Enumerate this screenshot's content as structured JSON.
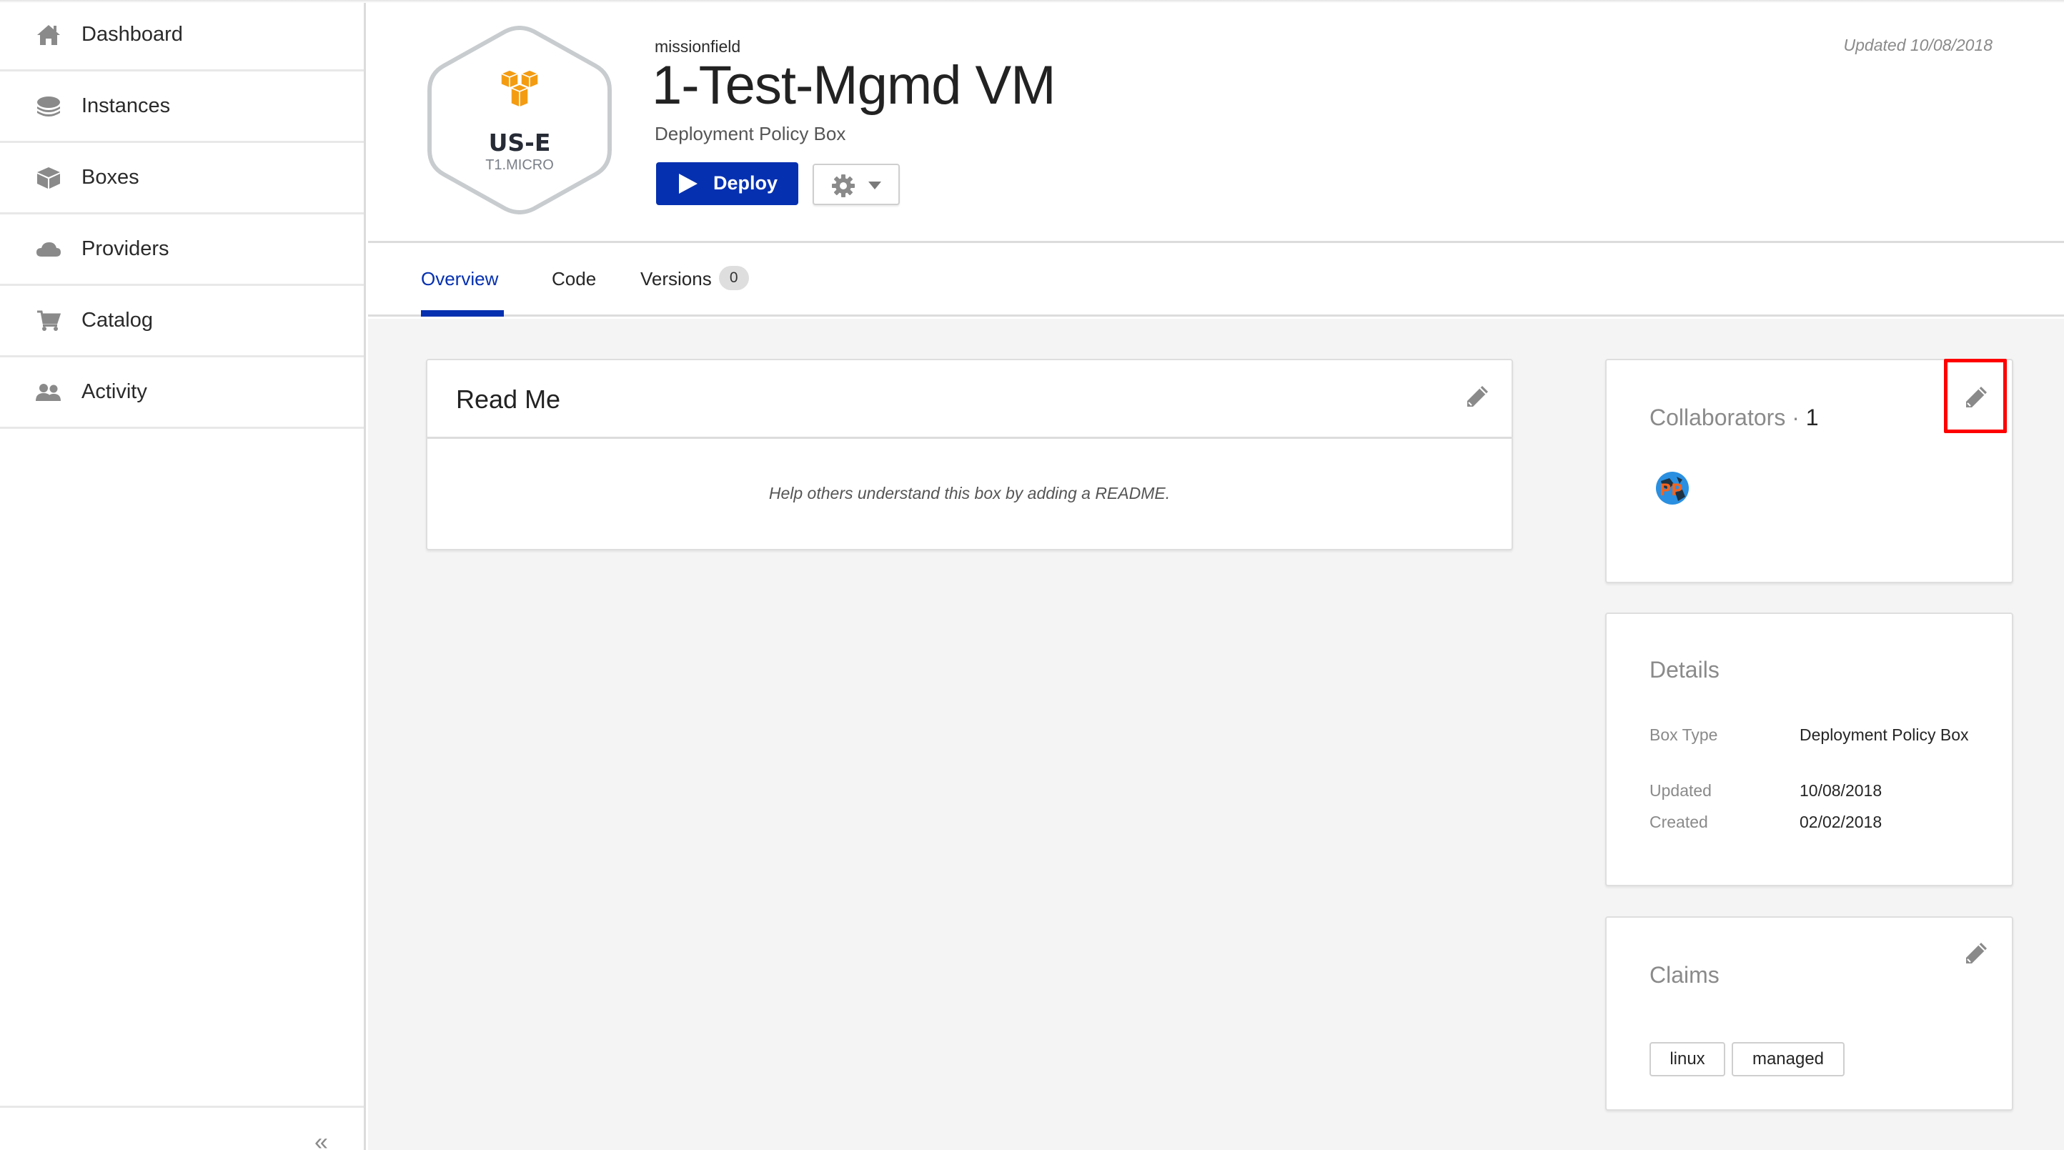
{
  "sidebar": {
    "items": [
      {
        "label": "Dashboard",
        "icon": "home-icon"
      },
      {
        "label": "Instances",
        "icon": "layers-icon"
      },
      {
        "label": "Boxes",
        "icon": "cube-icon"
      },
      {
        "label": "Providers",
        "icon": "cloud-icon"
      },
      {
        "label": "Catalog",
        "icon": "cart-icon"
      },
      {
        "label": "Activity",
        "icon": "users-icon"
      }
    ],
    "collapse_label": "«"
  },
  "header": {
    "badge": {
      "region": "US-E",
      "size": "T1.MICRO",
      "provider_icon": "aws-cubes-icon",
      "accent": "#f39c12"
    },
    "owner": "missionfield",
    "title": "1-Test-Mgmd VM",
    "subtitle": "Deployment Policy Box",
    "deploy_label": "Deploy",
    "settings_icon": "gear-icon",
    "updated": "Updated 10/08/2018"
  },
  "tabs": [
    {
      "label": "Overview",
      "active": true
    },
    {
      "label": "Code",
      "active": false
    },
    {
      "label": "Versions",
      "active": false,
      "count": "0"
    }
  ],
  "readme": {
    "title": "Read Me",
    "empty_text": "Help others understand this box by adding a README."
  },
  "collaborators": {
    "title": "Collaborators",
    "separator": " · ",
    "count": "1",
    "avatars": [
      {
        "initials": "PP"
      }
    ]
  },
  "details": {
    "title": "Details",
    "rows": [
      {
        "key": "Box Type",
        "value": "Deployment Policy Box"
      },
      {
        "key": "Updated",
        "value": "10/08/2018"
      },
      {
        "key": "Created",
        "value": "02/02/2018"
      }
    ]
  },
  "claims": {
    "title": "Claims",
    "tags": [
      "linux",
      "managed"
    ]
  },
  "colors": {
    "primary": "#0530b0",
    "icon_gray": "#8a8a8a",
    "background": "#f4f4f4",
    "highlight": "#ff0000"
  }
}
